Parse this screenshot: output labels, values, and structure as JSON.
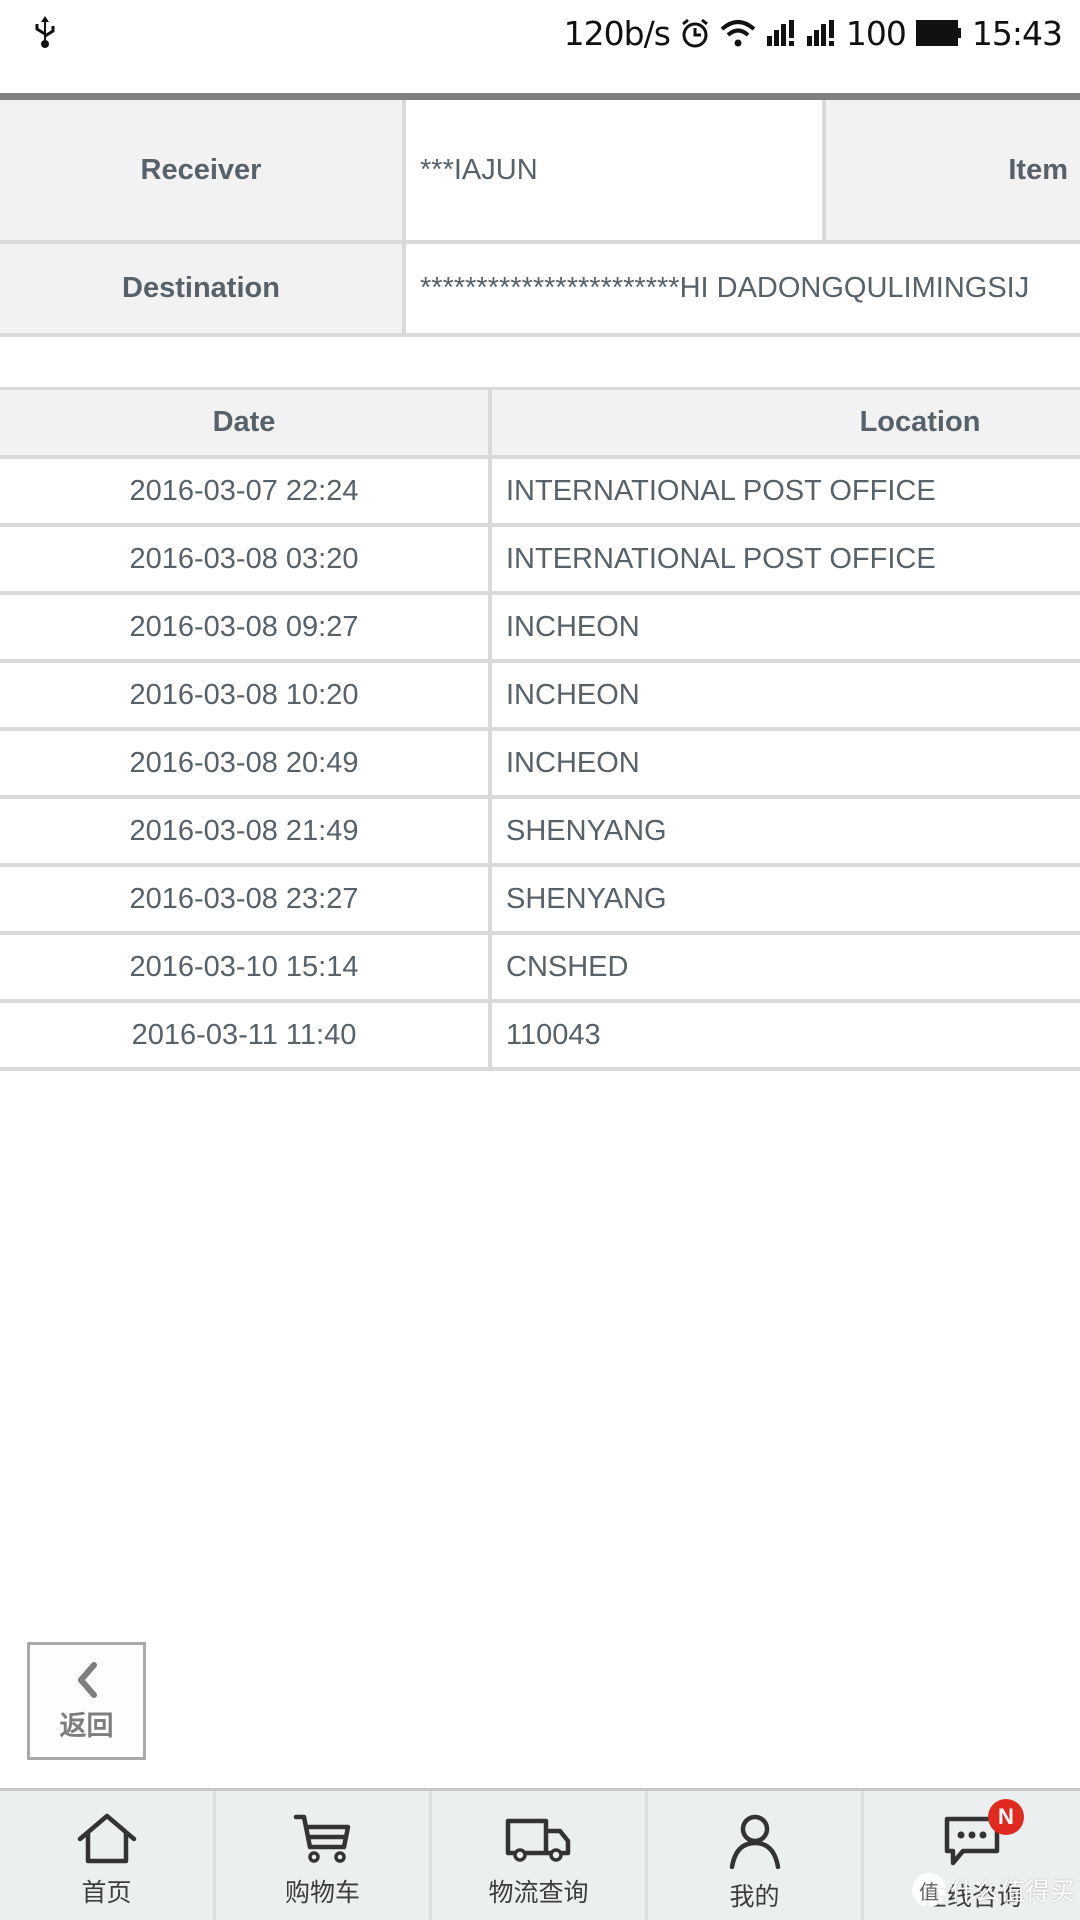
{
  "status_bar": {
    "network_speed": "120b/s",
    "battery_level": "100",
    "time": "15:43",
    "icons": [
      "usb-icon",
      "alarm-icon",
      "wifi-icon",
      "signal-sim1-icon",
      "signal-sim2-icon",
      "battery-icon"
    ]
  },
  "info": {
    "receiver_label": "Receiver",
    "receiver_value": "***IAJUN",
    "item_label": "Item",
    "destination_label": "Destination",
    "destination_value": "***********************HI DADONGQULIMINGSIJ"
  },
  "history": {
    "columns": [
      "Date",
      "Location"
    ],
    "rows": [
      {
        "date": "2016-03-07 22:24",
        "location": "INTERNATIONAL POST OFFICE"
      },
      {
        "date": "2016-03-08 03:20",
        "location": "INTERNATIONAL POST OFFICE"
      },
      {
        "date": "2016-03-08 09:27",
        "location": "INCHEON"
      },
      {
        "date": "2016-03-08 10:20",
        "location": "INCHEON"
      },
      {
        "date": "2016-03-08 20:49",
        "location": "INCHEON"
      },
      {
        "date": "2016-03-08 21:49",
        "location": "SHENYANG"
      },
      {
        "date": "2016-03-08 23:27",
        "location": "SHENYANG"
      },
      {
        "date": "2016-03-10 15:14",
        "location": "CNSHED"
      },
      {
        "date": "2016-03-11 11:40",
        "location": "110043"
      }
    ]
  },
  "back_button": {
    "label": "返回",
    "icon": "chevron-left-icon"
  },
  "bottom_nav": {
    "tabs": [
      {
        "label": "首页",
        "icon": "home-icon"
      },
      {
        "label": "购物车",
        "icon": "cart-icon"
      },
      {
        "label": "物流查询",
        "icon": "truck-icon"
      },
      {
        "label": "我的",
        "icon": "user-icon"
      },
      {
        "label": "在线咨询",
        "icon": "chat-icon",
        "badge": "N"
      }
    ]
  },
  "watermark": {
    "circle": "值",
    "text": "什么值得买"
  },
  "colors": {
    "text": "#56616a",
    "header_bg": "#f2f2f2",
    "border": "#d9d9d9",
    "nav_bg": "#eceff0",
    "badge": "#e02a20",
    "top_bar": "#7f7f7f"
  }
}
